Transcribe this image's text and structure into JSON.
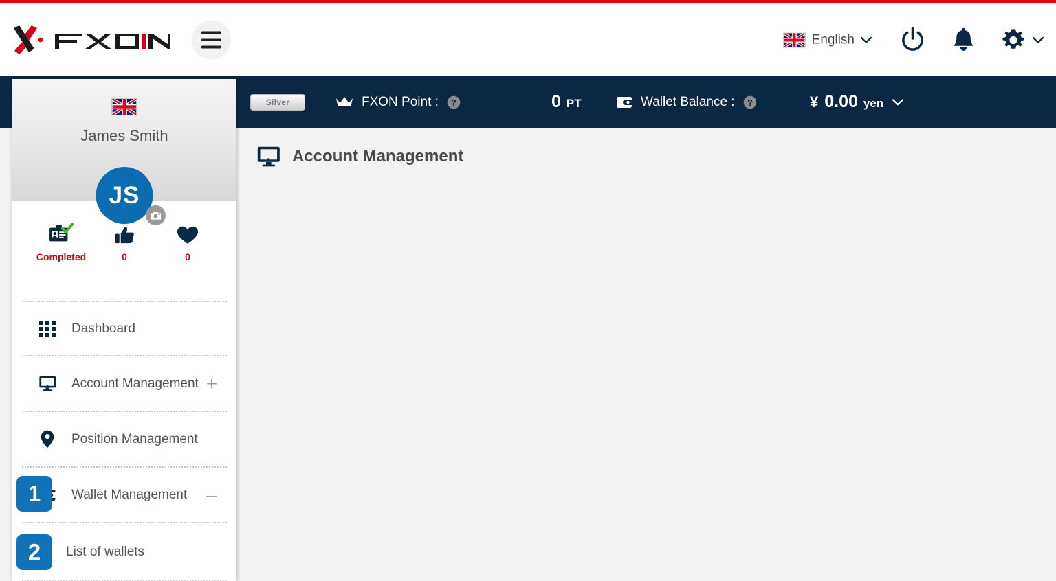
{
  "brand": {
    "name": "FXON",
    "logo_icon": "fxon-x-logo",
    "accent_red": "#e30613",
    "navy": "#0a2844",
    "blue": "#1172b8"
  },
  "header": {
    "menu_icon": "hamburger-icon",
    "language": {
      "flag_icon": "uk-flag-icon",
      "label": "English",
      "chevron_icon": "chevron-down-icon"
    },
    "power_icon": "power-icon",
    "notifications_icon": "bell-icon",
    "settings_icon": "gear-icon",
    "settings_chevron_icon": "chevron-down-icon"
  },
  "status_bar": {
    "rank_badge": "Silver",
    "point": {
      "icon": "crown-icon",
      "label": "FXON Point :",
      "help_icon": "help-circle-icon",
      "value": "0",
      "unit": "PT"
    },
    "wallet": {
      "icon": "wallet-icon",
      "label": "Wallet Balance :",
      "help_icon": "help-circle-icon",
      "currency_symbol": "¥",
      "value": "0.00",
      "unit": "yen",
      "chevron_icon": "chevron-down-icon"
    }
  },
  "sidebar": {
    "profile": {
      "flag_icon": "uk-flag-icon",
      "name": "James Smith",
      "avatar_initials": "JS",
      "camera_icon": "camera-icon"
    },
    "stats": [
      {
        "icon": "id-card-verified-icon",
        "label": "Completed"
      },
      {
        "icon": "thumbs-up-icon",
        "label": "0"
      },
      {
        "icon": "heart-icon",
        "label": "0"
      }
    ],
    "nav": [
      {
        "icon": "grid-icon",
        "label": "Dashboard",
        "toggle": ""
      },
      {
        "icon": "monitor-icon",
        "label": "Account Management",
        "toggle": "+"
      },
      {
        "icon": "map-pin-icon",
        "label": "Position Management",
        "toggle": ""
      },
      {
        "icon": "wallet-icon",
        "label": "Wallet Management",
        "toggle": "–"
      }
    ],
    "sub_nav": [
      {
        "label": "List of wallets"
      }
    ],
    "step_badges": [
      "1",
      "2"
    ]
  },
  "main": {
    "page_icon": "monitor-icon",
    "page_title": "Account Management"
  }
}
